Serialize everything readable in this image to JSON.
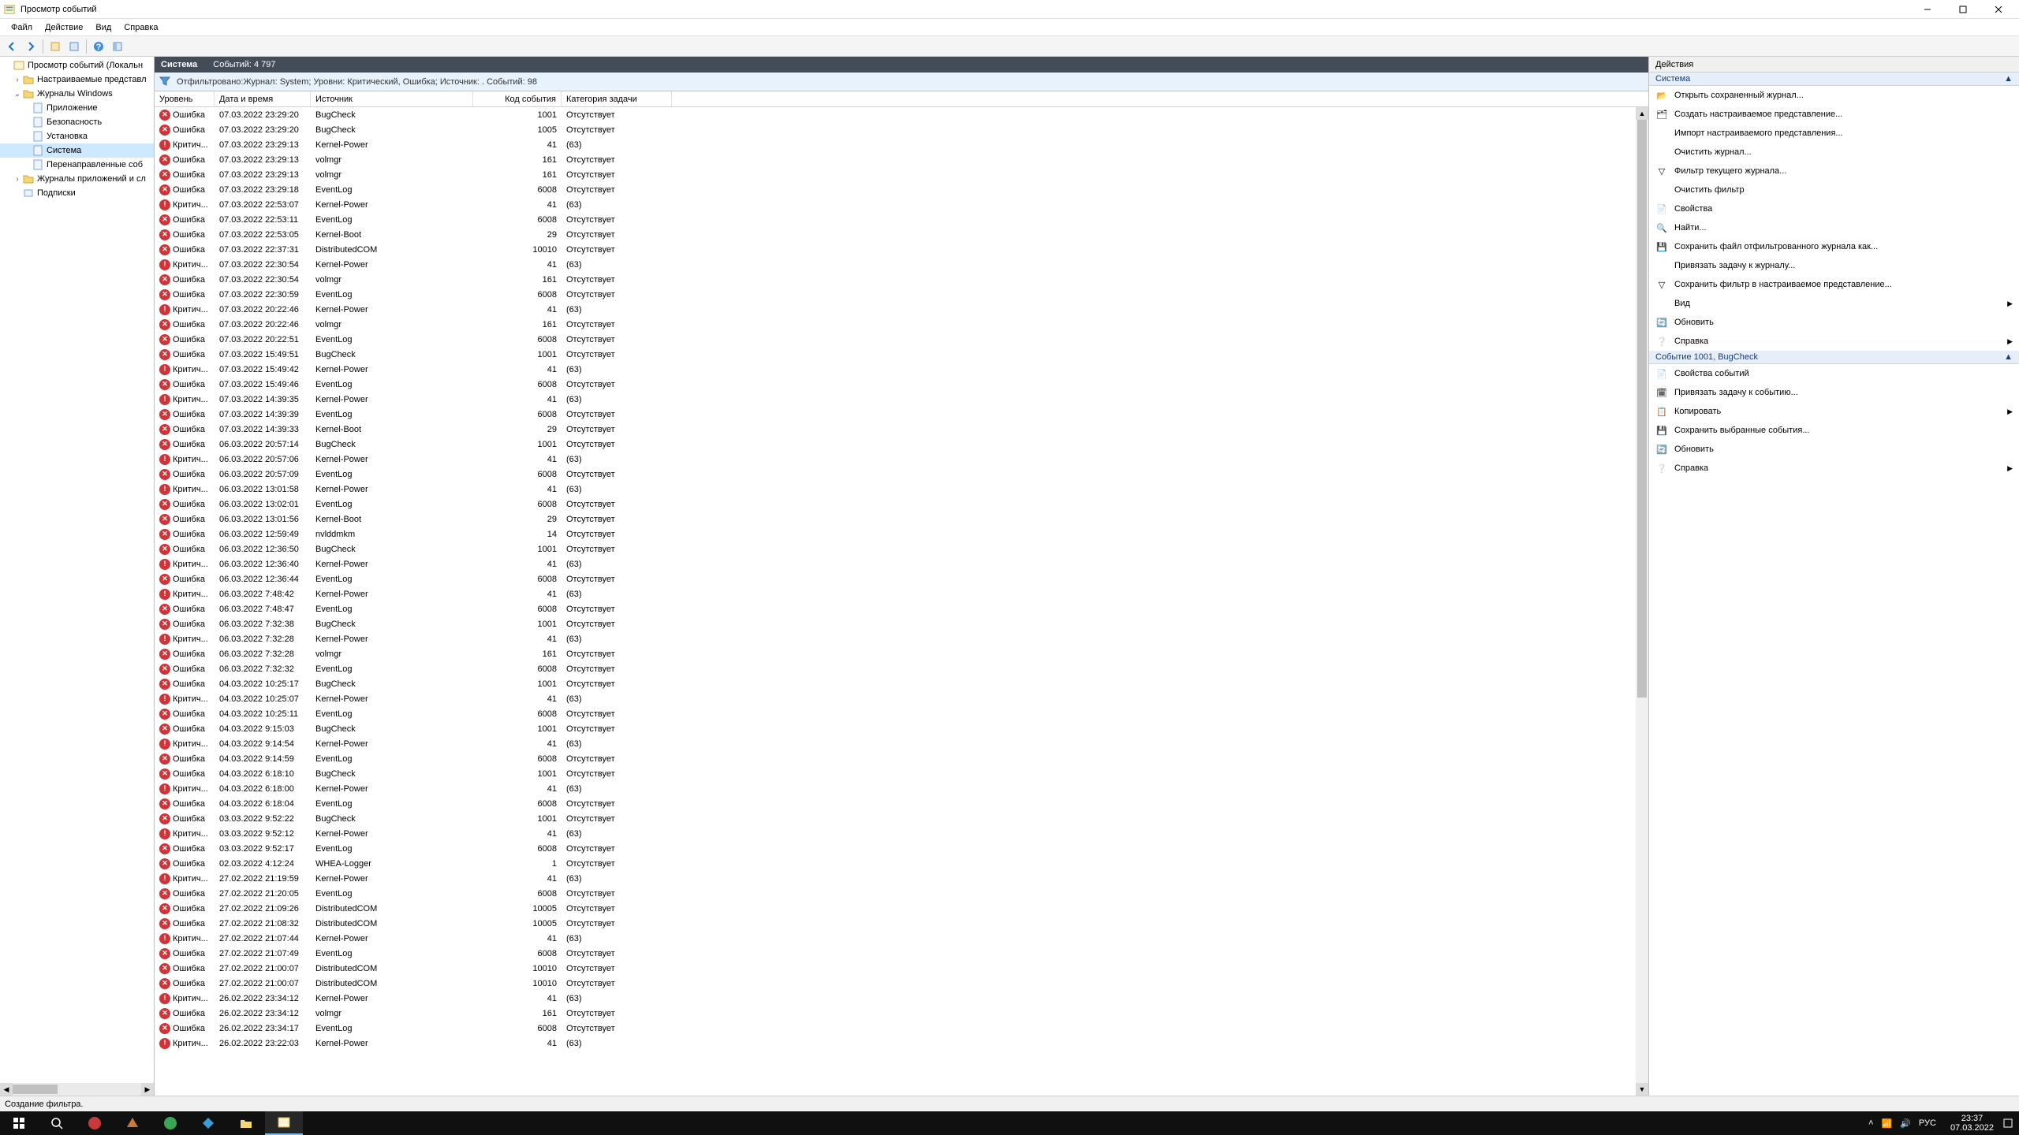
{
  "window": {
    "title": "Просмотр событий"
  },
  "menu": {
    "file": "Файл",
    "action": "Действие",
    "view": "Вид",
    "help": "Справка"
  },
  "tree": {
    "root": "Просмотр событий (Локальн",
    "custom_views": "Настраиваемые представл",
    "win_logs": "Журналы Windows",
    "app": "Приложение",
    "security": "Безопасность",
    "setup": "Установка",
    "system": "Система",
    "forwarded": "Перенаправленные соб",
    "apps_services": "Журналы приложений и сл",
    "subscriptions": "Подписки"
  },
  "center": {
    "title": "Система",
    "count_label": "Событий: 4 797",
    "filter_desc": "Отфильтровано:Журнал: System; Уровни: Критический, Ошибка; Источник: . Событий: 98"
  },
  "columns": {
    "level": "Уровень",
    "datetime": "Дата и время",
    "source": "Источник",
    "eventid": "Код события",
    "task": "Категория задачи"
  },
  "level_labels": {
    "error": "Ошибка",
    "critical": "Критич..."
  },
  "task_none": "Отсутствует",
  "task_63": "(63)",
  "events": [
    {
      "lvl": "error",
      "dt": "07.03.2022 23:29:20",
      "src": "BugCheck",
      "id": 1001,
      "task": "none"
    },
    {
      "lvl": "error",
      "dt": "07.03.2022 23:29:20",
      "src": "BugCheck",
      "id": 1005,
      "task": "none"
    },
    {
      "lvl": "critical",
      "dt": "07.03.2022 23:29:13",
      "src": "Kernel-Power",
      "id": 41,
      "task": "63"
    },
    {
      "lvl": "error",
      "dt": "07.03.2022 23:29:13",
      "src": "volmgr",
      "id": 161,
      "task": "none"
    },
    {
      "lvl": "error",
      "dt": "07.03.2022 23:29:13",
      "src": "volmgr",
      "id": 161,
      "task": "none"
    },
    {
      "lvl": "error",
      "dt": "07.03.2022 23:29:18",
      "src": "EventLog",
      "id": 6008,
      "task": "none"
    },
    {
      "lvl": "critical",
      "dt": "07.03.2022 22:53:07",
      "src": "Kernel-Power",
      "id": 41,
      "task": "63"
    },
    {
      "lvl": "error",
      "dt": "07.03.2022 22:53:11",
      "src": "EventLog",
      "id": 6008,
      "task": "none"
    },
    {
      "lvl": "error",
      "dt": "07.03.2022 22:53:05",
      "src": "Kernel-Boot",
      "id": 29,
      "task": "none"
    },
    {
      "lvl": "error",
      "dt": "07.03.2022 22:37:31",
      "src": "DistributedCOM",
      "id": 10010,
      "task": "none"
    },
    {
      "lvl": "critical",
      "dt": "07.03.2022 22:30:54",
      "src": "Kernel-Power",
      "id": 41,
      "task": "63"
    },
    {
      "lvl": "error",
      "dt": "07.03.2022 22:30:54",
      "src": "volmgr",
      "id": 161,
      "task": "none"
    },
    {
      "lvl": "error",
      "dt": "07.03.2022 22:30:59",
      "src": "EventLog",
      "id": 6008,
      "task": "none"
    },
    {
      "lvl": "critical",
      "dt": "07.03.2022 20:22:46",
      "src": "Kernel-Power",
      "id": 41,
      "task": "63"
    },
    {
      "lvl": "error",
      "dt": "07.03.2022 20:22:46",
      "src": "volmgr",
      "id": 161,
      "task": "none"
    },
    {
      "lvl": "error",
      "dt": "07.03.2022 20:22:51",
      "src": "EventLog",
      "id": 6008,
      "task": "none"
    },
    {
      "lvl": "error",
      "dt": "07.03.2022 15:49:51",
      "src": "BugCheck",
      "id": 1001,
      "task": "none"
    },
    {
      "lvl": "critical",
      "dt": "07.03.2022 15:49:42",
      "src": "Kernel-Power",
      "id": 41,
      "task": "63"
    },
    {
      "lvl": "error",
      "dt": "07.03.2022 15:49:46",
      "src": "EventLog",
      "id": 6008,
      "task": "none"
    },
    {
      "lvl": "critical",
      "dt": "07.03.2022 14:39:35",
      "src": "Kernel-Power",
      "id": 41,
      "task": "63"
    },
    {
      "lvl": "error",
      "dt": "07.03.2022 14:39:39",
      "src": "EventLog",
      "id": 6008,
      "task": "none"
    },
    {
      "lvl": "error",
      "dt": "07.03.2022 14:39:33",
      "src": "Kernel-Boot",
      "id": 29,
      "task": "none"
    },
    {
      "lvl": "error",
      "dt": "06.03.2022 20:57:14",
      "src": "BugCheck",
      "id": 1001,
      "task": "none"
    },
    {
      "lvl": "critical",
      "dt": "06.03.2022 20:57:06",
      "src": "Kernel-Power",
      "id": 41,
      "task": "63"
    },
    {
      "lvl": "error",
      "dt": "06.03.2022 20:57:09",
      "src": "EventLog",
      "id": 6008,
      "task": "none"
    },
    {
      "lvl": "critical",
      "dt": "06.03.2022 13:01:58",
      "src": "Kernel-Power",
      "id": 41,
      "task": "63"
    },
    {
      "lvl": "error",
      "dt": "06.03.2022 13:02:01",
      "src": "EventLog",
      "id": 6008,
      "task": "none"
    },
    {
      "lvl": "error",
      "dt": "06.03.2022 13:01:56",
      "src": "Kernel-Boot",
      "id": 29,
      "task": "none"
    },
    {
      "lvl": "error",
      "dt": "06.03.2022 12:59:49",
      "src": "nvlddmkm",
      "id": 14,
      "task": "none"
    },
    {
      "lvl": "error",
      "dt": "06.03.2022 12:36:50",
      "src": "BugCheck",
      "id": 1001,
      "task": "none"
    },
    {
      "lvl": "critical",
      "dt": "06.03.2022 12:36:40",
      "src": "Kernel-Power",
      "id": 41,
      "task": "63"
    },
    {
      "lvl": "error",
      "dt": "06.03.2022 12:36:44",
      "src": "EventLog",
      "id": 6008,
      "task": "none"
    },
    {
      "lvl": "critical",
      "dt": "06.03.2022 7:48:42",
      "src": "Kernel-Power",
      "id": 41,
      "task": "63"
    },
    {
      "lvl": "error",
      "dt": "06.03.2022 7:48:47",
      "src": "EventLog",
      "id": 6008,
      "task": "none"
    },
    {
      "lvl": "error",
      "dt": "06.03.2022 7:32:38",
      "src": "BugCheck",
      "id": 1001,
      "task": "none"
    },
    {
      "lvl": "critical",
      "dt": "06.03.2022 7:32:28",
      "src": "Kernel-Power",
      "id": 41,
      "task": "63"
    },
    {
      "lvl": "error",
      "dt": "06.03.2022 7:32:28",
      "src": "volmgr",
      "id": 161,
      "task": "none"
    },
    {
      "lvl": "error",
      "dt": "06.03.2022 7:32:32",
      "src": "EventLog",
      "id": 6008,
      "task": "none"
    },
    {
      "lvl": "error",
      "dt": "04.03.2022 10:25:17",
      "src": "BugCheck",
      "id": 1001,
      "task": "none"
    },
    {
      "lvl": "critical",
      "dt": "04.03.2022 10:25:07",
      "src": "Kernel-Power",
      "id": 41,
      "task": "63"
    },
    {
      "lvl": "error",
      "dt": "04.03.2022 10:25:11",
      "src": "EventLog",
      "id": 6008,
      "task": "none"
    },
    {
      "lvl": "error",
      "dt": "04.03.2022 9:15:03",
      "src": "BugCheck",
      "id": 1001,
      "task": "none"
    },
    {
      "lvl": "critical",
      "dt": "04.03.2022 9:14:54",
      "src": "Kernel-Power",
      "id": 41,
      "task": "63"
    },
    {
      "lvl": "error",
      "dt": "04.03.2022 9:14:59",
      "src": "EventLog",
      "id": 6008,
      "task": "none"
    },
    {
      "lvl": "error",
      "dt": "04.03.2022 6:18:10",
      "src": "BugCheck",
      "id": 1001,
      "task": "none"
    },
    {
      "lvl": "critical",
      "dt": "04.03.2022 6:18:00",
      "src": "Kernel-Power",
      "id": 41,
      "task": "63"
    },
    {
      "lvl": "error",
      "dt": "04.03.2022 6:18:04",
      "src": "EventLog",
      "id": 6008,
      "task": "none"
    },
    {
      "lvl": "error",
      "dt": "03.03.2022 9:52:22",
      "src": "BugCheck",
      "id": 1001,
      "task": "none"
    },
    {
      "lvl": "critical",
      "dt": "03.03.2022 9:52:12",
      "src": "Kernel-Power",
      "id": 41,
      "task": "63"
    },
    {
      "lvl": "error",
      "dt": "03.03.2022 9:52:17",
      "src": "EventLog",
      "id": 6008,
      "task": "none"
    },
    {
      "lvl": "error",
      "dt": "02.03.2022 4:12:24",
      "src": "WHEA-Logger",
      "id": 1,
      "task": "none"
    },
    {
      "lvl": "critical",
      "dt": "27.02.2022 21:19:59",
      "src": "Kernel-Power",
      "id": 41,
      "task": "63"
    },
    {
      "lvl": "error",
      "dt": "27.02.2022 21:20:05",
      "src": "EventLog",
      "id": 6008,
      "task": "none"
    },
    {
      "lvl": "error",
      "dt": "27.02.2022 21:09:26",
      "src": "DistributedCOM",
      "id": 10005,
      "task": "none"
    },
    {
      "lvl": "error",
      "dt": "27.02.2022 21:08:32",
      "src": "DistributedCOM",
      "id": 10005,
      "task": "none"
    },
    {
      "lvl": "critical",
      "dt": "27.02.2022 21:07:44",
      "src": "Kernel-Power",
      "id": 41,
      "task": "63"
    },
    {
      "lvl": "error",
      "dt": "27.02.2022 21:07:49",
      "src": "EventLog",
      "id": 6008,
      "task": "none"
    },
    {
      "lvl": "error",
      "dt": "27.02.2022 21:00:07",
      "src": "DistributedCOM",
      "id": 10010,
      "task": "none"
    },
    {
      "lvl": "error",
      "dt": "27.02.2022 21:00:07",
      "src": "DistributedCOM",
      "id": 10010,
      "task": "none"
    },
    {
      "lvl": "critical",
      "dt": "26.02.2022 23:34:12",
      "src": "Kernel-Power",
      "id": 41,
      "task": "63"
    },
    {
      "lvl": "error",
      "dt": "26.02.2022 23:34:12",
      "src": "volmgr",
      "id": 161,
      "task": "none"
    },
    {
      "lvl": "error",
      "dt": "26.02.2022 23:34:17",
      "src": "EventLog",
      "id": 6008,
      "task": "none"
    },
    {
      "lvl": "critical",
      "dt": "26.02.2022 23:22:03",
      "src": "Kernel-Power",
      "id": 41,
      "task": "63"
    }
  ],
  "actions": {
    "pane_title": "Действия",
    "group1": "Система",
    "open_saved": "Открыть сохраненный журнал...",
    "create_view": "Создать настраиваемое представление...",
    "import_view": "Импорт настраиваемого представления...",
    "clear_log": "Очистить журнал...",
    "filter_log": "Фильтр текущего журнала...",
    "clear_filter": "Очистить фильтр",
    "properties": "Свойства",
    "find": "Найти...",
    "save_filtered": "Сохранить файл отфильтрованного журнала как...",
    "attach_task_log": "Привязать задачу к журналу...",
    "save_filter_view": "Сохранить фильтр в настраиваемое представление...",
    "view": "Вид",
    "refresh": "Обновить",
    "help": "Справка",
    "group2": "Событие 1001, BugCheck",
    "event_props": "Свойства событий",
    "attach_task_event": "Привязать задачу к событию...",
    "copy": "Копировать",
    "save_selected": "Сохранить выбранные события...",
    "refresh2": "Обновить",
    "help2": "Справка"
  },
  "status": "Создание фильтра.",
  "sys": {
    "lang": "РУС",
    "time": "23:37",
    "date": "07.03.2022"
  }
}
